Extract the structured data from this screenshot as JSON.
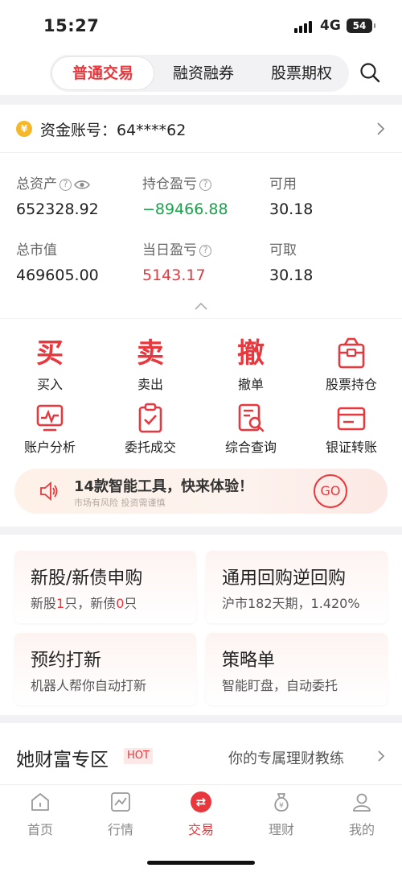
{
  "status_bar": {
    "time": "15:27",
    "network": "4G",
    "battery": "54"
  },
  "top_tabs": [
    "普通交易",
    "融资融券",
    "股票期权"
  ],
  "account": {
    "label": "资金账号：64****62",
    "coin": "¥"
  },
  "stats": [
    {
      "label": "总资产",
      "value": "652328.92",
      "tone": "normal"
    },
    {
      "label": "持仓盈亏",
      "value": "−89466.88",
      "tone": "green"
    },
    {
      "label": "可用",
      "value": "30.18",
      "tone": "normal"
    },
    {
      "label": "总市值",
      "value": "469605.00",
      "tone": "normal"
    },
    {
      "label": "当日盈亏",
      "value": "5143.17",
      "tone": "red"
    },
    {
      "label": "可取",
      "value": "30.18",
      "tone": "normal"
    }
  ],
  "functions": [
    {
      "glyph": "买",
      "label": "买入"
    },
    {
      "glyph": "卖",
      "label": "卖出"
    },
    {
      "glyph": "撤",
      "label": "撤单"
    },
    {
      "icon": "bag-icon",
      "label": "股票持仓"
    },
    {
      "icon": "chart-monitor-icon",
      "label": "账户分析"
    },
    {
      "icon": "clipboard-check-icon",
      "label": "委托成交"
    },
    {
      "icon": "doc-search-icon",
      "label": "综合查询"
    },
    {
      "icon": "card-icon",
      "label": "银证转账"
    }
  ],
  "promo": {
    "title": "14款智能工具，快来体验！",
    "subtitle": "市场有风险 投资需谨慎",
    "button": "GO"
  },
  "products": [
    {
      "title": "新股/新债申购",
      "sub_parts": [
        "新股",
        "1",
        "只，新债",
        "0",
        "只"
      ]
    },
    {
      "title": "通用回购逆回购",
      "sub": "沪市182天期，1.420%"
    },
    {
      "title": "预约打新",
      "sub": "机器人帮你自动打新"
    },
    {
      "title": "策略单",
      "sub": "智能盯盘，自动委托"
    }
  ],
  "wealth": {
    "title": "她财富专区",
    "badge": "HOT",
    "link": "你的专属理财教练"
  },
  "bottom_nav": [
    "首页",
    "行情",
    "交易",
    "理财",
    "我的"
  ],
  "colors": {
    "accent": "#e8373d",
    "gain_green": "#17a34a"
  }
}
